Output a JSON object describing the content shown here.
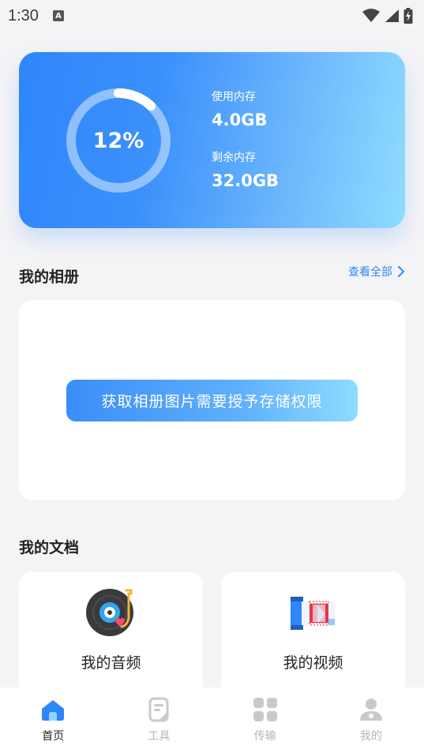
{
  "status_bar": {
    "time": "1:30",
    "indicator_letter": "A"
  },
  "storage": {
    "percent_label": "12%",
    "percent_value": 0.12,
    "used_label": "使用内存",
    "used_value": "4.0GB",
    "free_label": "剩余内存",
    "free_value": "32.0GB"
  },
  "album": {
    "title": "我的相册",
    "view_all": "查看全部",
    "permission_button": "获取相册图片需要授予存储权限"
  },
  "documents": {
    "title": "我的文档",
    "items": [
      {
        "label": "我的音频",
        "icon": "vinyl-record-icon"
      },
      {
        "label": "我的视频",
        "icon": "film-reel-icon"
      }
    ]
  },
  "nav": {
    "items": [
      {
        "label": "首页",
        "icon": "home-icon",
        "active": true
      },
      {
        "label": "工具",
        "icon": "note-tool-icon",
        "active": false
      },
      {
        "label": "传输",
        "icon": "grid-apps-icon",
        "active": false
      },
      {
        "label": "我的",
        "icon": "user-icon",
        "active": false
      }
    ]
  },
  "colors": {
    "accent": "#2f86f9",
    "card_gradient_end": "#8fdcff",
    "inactive_nav": "#b5b5b8"
  }
}
